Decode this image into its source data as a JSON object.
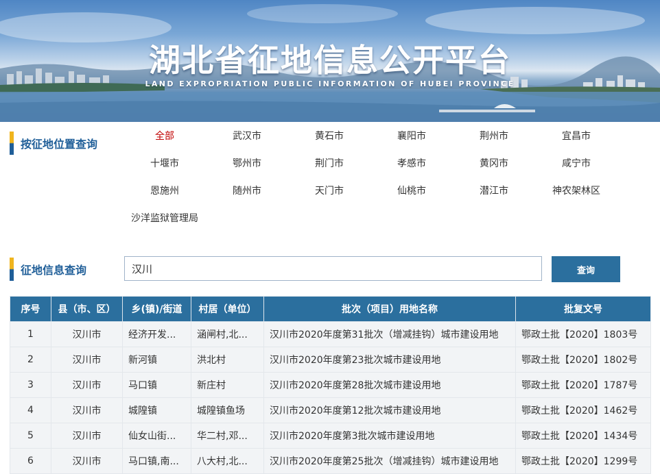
{
  "banner": {
    "title": "湖北省征地信息公开平台",
    "subtitle": "LAND EXPROPRIATION PUBLIC INFORMATION OF HUBEI PROVINCE"
  },
  "location_filter": {
    "label": "按征地位置查询",
    "active_index": 0,
    "regions": [
      "全部",
      "武汉市",
      "黄石市",
      "襄阳市",
      "荆州市",
      "宜昌市",
      "十堰市",
      "鄂州市",
      "荆门市",
      "孝感市",
      "黄冈市",
      "咸宁市",
      "恩施州",
      "随州市",
      "天门市",
      "仙桃市",
      "潜江市",
      "神农架林区",
      "沙洋监狱管理局"
    ]
  },
  "search": {
    "label": "征地信息查询",
    "value": "汉川",
    "button_label": "查询"
  },
  "table": {
    "columns": [
      "序号",
      "县（市、区）",
      "乡(镇)/街道",
      "村居（单位）",
      "批次（项目）用地名称",
      "批复文号"
    ],
    "rows": [
      [
        "1",
        "汉川市",
        "经济开发...",
        "涵闸村,北...",
        "汉川市2020年度第31批次（增减挂钩）城市建设用地",
        "鄂政土批【2020】1803号"
      ],
      [
        "2",
        "汉川市",
        "新河镇",
        "洪北村",
        "汉川市2020年度第23批次城市建设用地",
        "鄂政土批【2020】1802号"
      ],
      [
        "3",
        "汉川市",
        "马口镇",
        "新庄村",
        "汉川市2020年度第28批次城市建设用地",
        "鄂政土批【2020】1787号"
      ],
      [
        "4",
        "汉川市",
        "城隍镇",
        "城隍镇鱼场",
        "汉川市2020年度第12批次城市建设用地",
        "鄂政土批【2020】1462号"
      ],
      [
        "5",
        "汉川市",
        "仙女山街...",
        "华二村,邓...",
        "汉川市2020年度第3批次城市建设用地",
        "鄂政土批【2020】1434号"
      ],
      [
        "6",
        "汉川市",
        "马口镇,南...",
        "八大村,北...",
        "汉川市2020年度第25批次（增减挂钩）城市建设用地",
        "鄂政土批【2020】1299号"
      ]
    ]
  }
}
